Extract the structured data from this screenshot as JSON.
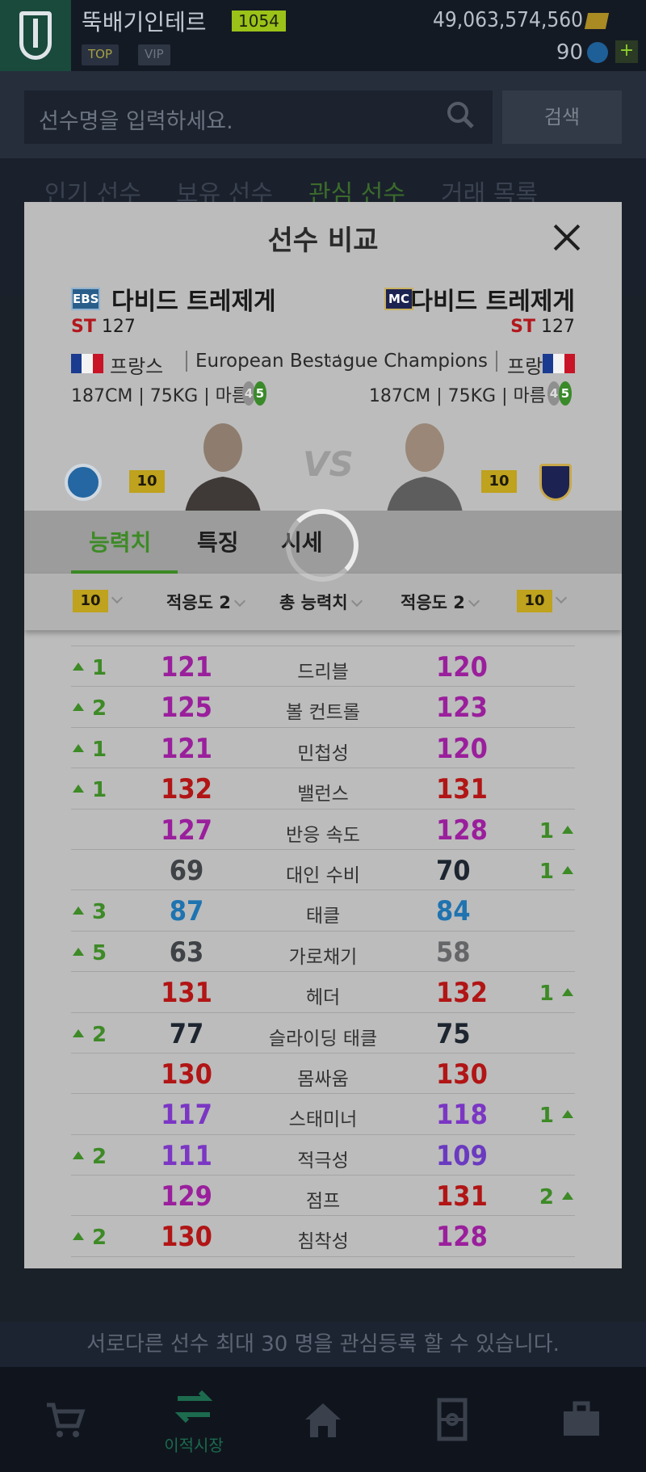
{
  "profile": {
    "nickname": "뚝배기인테르",
    "level": "1054",
    "tag_top": "TOP",
    "tag_vip": "VIP",
    "coins": "49,063,574,560",
    "points": "90",
    "plus": "+"
  },
  "search": {
    "placeholder": "선수명을 입력하세요.",
    "button": "검색"
  },
  "bg_tabs": [
    "인기 선수",
    "보유 선수",
    "관심 선수",
    "거래 목록"
  ],
  "notice": "서로다른 선수 최대 30 명을 관심등록 할 수 있습니다.",
  "bottom_nav": {
    "transfer_label": "이적시장"
  },
  "modal": {
    "title": "선수 비교",
    "vs": "VS",
    "left_player": {
      "season": "EBS",
      "name": "다비드 트레제게",
      "position": "ST",
      "ovr": "127",
      "nation": "프랑스",
      "league": "European Best Stars",
      "height": "187CM",
      "weight": "75KG",
      "build": "마름",
      "weak_foot": "4",
      "strong_foot": "5",
      "grade": "10"
    },
    "right_player": {
      "season": "MC",
      "name": "다비드 트레제게",
      "position": "ST",
      "ovr": "127",
      "nation": "프랑스",
      "league": "Multi-League Champions",
      "height": "187CM",
      "weight": "75KG",
      "build": "마름",
      "weak_foot": "4",
      "strong_foot": "5",
      "grade": "10"
    },
    "tabs": [
      "능력치",
      "특징",
      "시세"
    ],
    "selectors": {
      "left_grade": "10",
      "left_adapt": "적응도 2",
      "mode": "총 능력치",
      "right_adapt": "적응도 2",
      "right_grade": "10"
    },
    "stats": [
      {
        "name": "드리블",
        "left": "121",
        "right": "120",
        "left_color": "#9a1f9c",
        "right_color": "#9a1f9c",
        "left_diff": "1",
        "right_diff": ""
      },
      {
        "name": "볼 컨트롤",
        "left": "125",
        "right": "123",
        "left_color": "#9a1f9c",
        "right_color": "#9a1f9c",
        "left_diff": "2",
        "right_diff": ""
      },
      {
        "name": "민첩성",
        "left": "121",
        "right": "120",
        "left_color": "#9a1f9c",
        "right_color": "#9a1f9c",
        "left_diff": "1",
        "right_diff": ""
      },
      {
        "name": "밸런스",
        "left": "132",
        "right": "131",
        "left_color": "#b11515",
        "right_color": "#b11515",
        "left_diff": "1",
        "right_diff": ""
      },
      {
        "name": "반응 속도",
        "left": "127",
        "right": "128",
        "left_color": "#9a1f9c",
        "right_color": "#9a1f9c",
        "left_diff": "",
        "right_diff": "1"
      },
      {
        "name": "대인 수비",
        "left": "69",
        "right": "70",
        "left_color": "#3f4246",
        "right_color": "#1d2630",
        "left_diff": "",
        "right_diff": "1"
      },
      {
        "name": "태클",
        "left": "87",
        "right": "84",
        "left_color": "#1f73b0",
        "right_color": "#1f73b0",
        "left_diff": "3",
        "right_diff": ""
      },
      {
        "name": "가로채기",
        "left": "63",
        "right": "58",
        "left_color": "#3f4246",
        "right_color": "#646668",
        "left_diff": "5",
        "right_diff": ""
      },
      {
        "name": "헤더",
        "left": "131",
        "right": "132",
        "left_color": "#b11515",
        "right_color": "#b11515",
        "left_diff": "",
        "right_diff": "1"
      },
      {
        "name": "슬라이딩 태클",
        "left": "77",
        "right": "75",
        "left_color": "#1d2630",
        "right_color": "#1d2630",
        "left_diff": "2",
        "right_diff": ""
      },
      {
        "name": "몸싸움",
        "left": "130",
        "right": "130",
        "left_color": "#b11515",
        "right_color": "#b11515",
        "left_diff": "",
        "right_diff": ""
      },
      {
        "name": "스태미너",
        "left": "117",
        "right": "118",
        "left_color": "#7b36c4",
        "right_color": "#7b36c4",
        "left_diff": "",
        "right_diff": "1"
      },
      {
        "name": "적극성",
        "left": "111",
        "right": "109",
        "left_color": "#7b36c4",
        "right_color": "#6a3ac0",
        "left_diff": "2",
        "right_diff": ""
      },
      {
        "name": "점프",
        "left": "129",
        "right": "131",
        "left_color": "#9a1f9c",
        "right_color": "#b11515",
        "left_diff": "",
        "right_diff": "2"
      },
      {
        "name": "침착성",
        "left": "130",
        "right": "128",
        "left_color": "#b11515",
        "right_color": "#9a1f9c",
        "left_diff": "2",
        "right_diff": ""
      }
    ]
  }
}
